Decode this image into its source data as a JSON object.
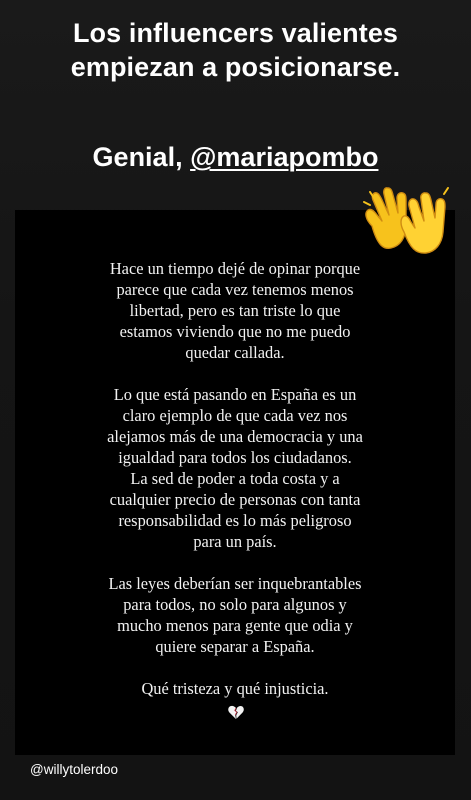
{
  "story": {
    "headline_lines": [
      "Los influencers valientes",
      "empiezan a posicionarse."
    ],
    "mention_prefix": "Genial, ",
    "mention": "@mariapombo",
    "sticker_icon": "raising-hands-emoji",
    "credit_handle": "@willytolerdoo"
  },
  "post": {
    "paragraphs": [
      [
        "Hace un tiempo dejé de opinar porque",
        "parece que cada vez tenemos menos",
        "libertad, pero es tan triste lo que",
        "estamos viviendo que no me puedo",
        "quedar callada."
      ],
      [
        "Lo que está pasando en España es un",
        "claro ejemplo de que cada vez nos",
        "alejamos más de una democracia y una",
        "igualdad para todos los ciudadanos.",
        "La sed de poder a toda costa y a",
        "cualquier precio de personas con tanta",
        "responsabilidad es lo más peligroso",
        "para un país."
      ],
      [
        "Las leyes deberían ser inquebrantables",
        "para todos, no solo para algunos y",
        "mucho menos para gente que odia y",
        "quiere separar a España."
      ],
      [
        "Qué tristeza y qué injusticia."
      ]
    ],
    "end_icon": "broken-heart-emoji",
    "colors": {
      "background": "#000000",
      "text": "#f2f2f2"
    }
  },
  "colors": {
    "story_background": "#151515",
    "headline": "#ffffff"
  }
}
